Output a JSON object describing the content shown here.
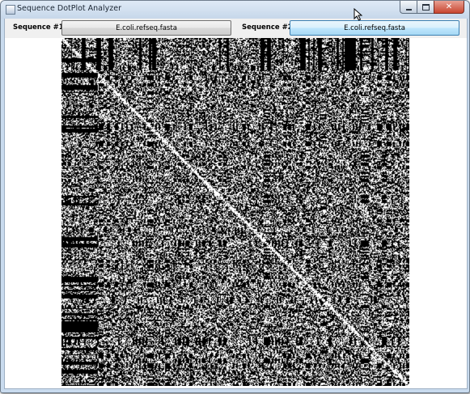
{
  "window": {
    "title": "Sequence DotPlot Analyzer",
    "controls": {
      "minimize_icon": "minimize-icon",
      "maximize_icon": "maximize-icon",
      "close_icon": "close-icon"
    }
  },
  "toolbar": {
    "sequence1": {
      "label": "Sequence #1",
      "file": "E.coli.refseq.fasta"
    },
    "sequence2": {
      "label": "Sequence #2",
      "file": "E.coli.refseq.fasta"
    }
  },
  "dotplot": {
    "description_type": "dot matrix plot",
    "foreground": "#000000",
    "background": "#ffffff"
  },
  "colors": {
    "titlebar": "#c6d7ea",
    "close_button": "#c8452f",
    "focused_button": "#a7d9f5"
  }
}
